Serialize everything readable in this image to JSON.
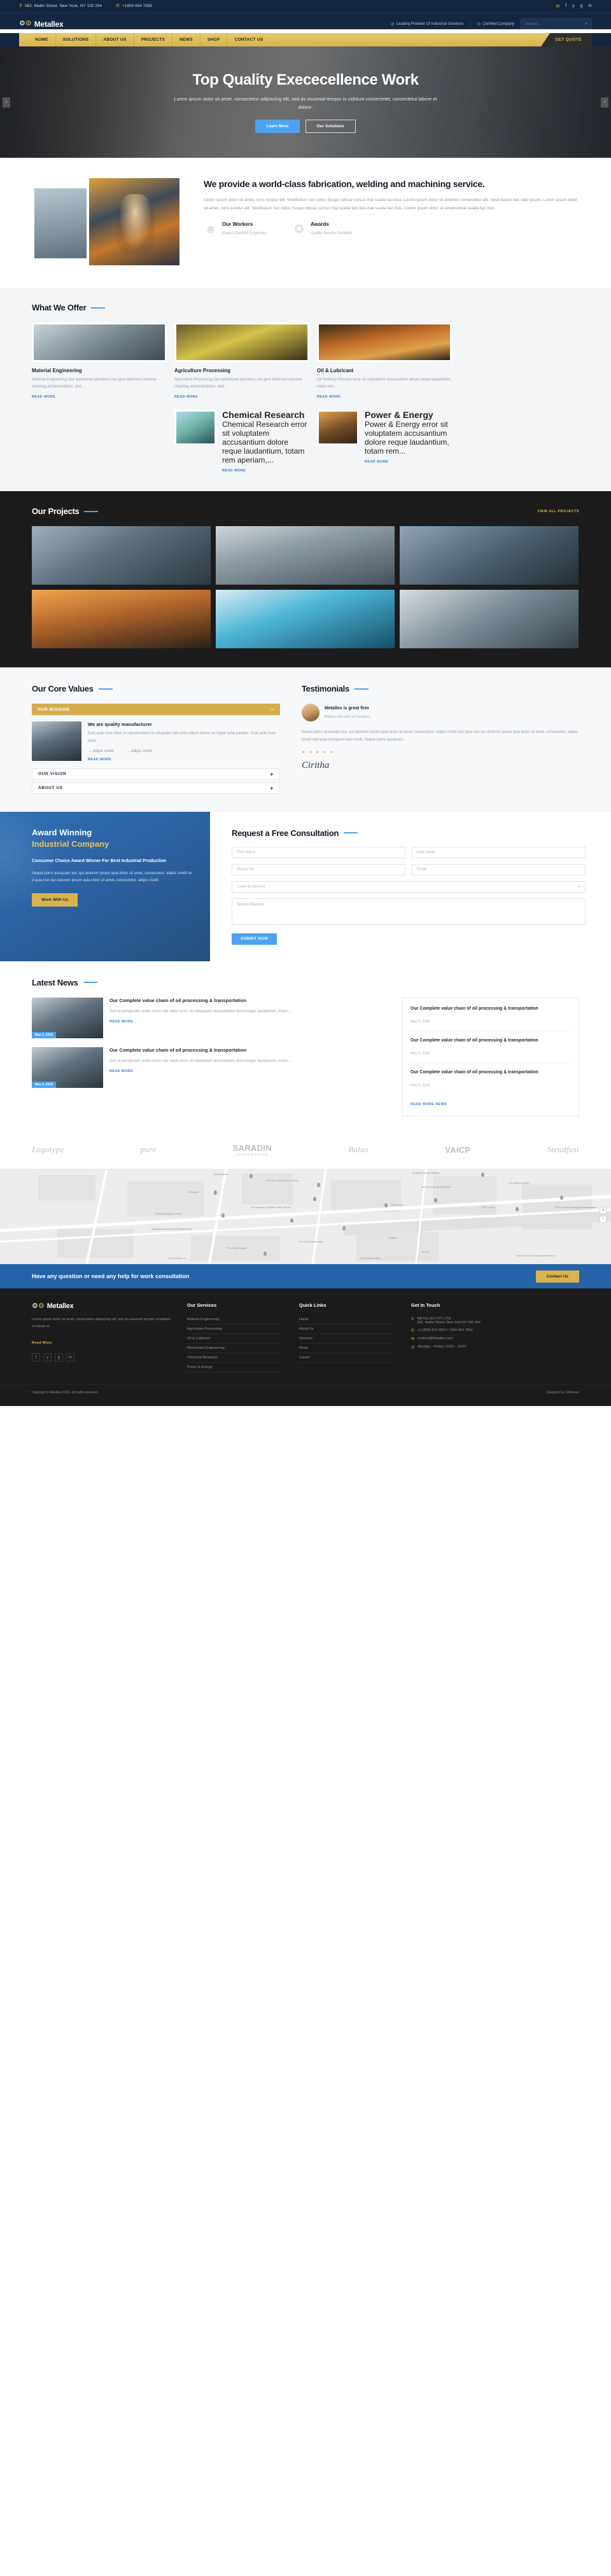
{
  "topbar": {
    "address": "562, Mallin Street, New Youk, NY 100 254",
    "phone": "+1800 654 7895",
    "social": [
      "✉",
      "f",
      "y",
      "g",
      "in"
    ]
  },
  "header": {
    "logo": "Metallex",
    "badges": [
      "Leading Provider Of Industrial Solutions",
      "Certified Company"
    ],
    "search_placeholder": "Search..."
  },
  "nav": {
    "items": [
      "HOME",
      "SOLUTIONS",
      "ABOUT US",
      "PROJECTS",
      "NEWS",
      "SHOP",
      "CONTACT US"
    ],
    "quote_label": "GET QUOTE"
  },
  "hero": {
    "title": "Top Quality Exececellence Work",
    "subtitle": "Lorem ipsum dolor sit amet, consectetur adipiscing elit, sed do eiusmod tempor in cididunt consectetet, consectetut labore et dolore.",
    "primary_btn": "Learn More",
    "secondary_btn": "Our Solutions"
  },
  "about": {
    "heading": "We provide a world-class fabrication, welding and machining service.",
    "paragraph": "Lorem ipsum dolor sit amet, cons ectetur elit. Vestibulum nec odios Suspe ndisse cursus mal suada faci lisis. Lorem ipsum dolor sit ametion consectetur elit. Vesti bulum nec odio ipsum. Lorem ipsum dolor sit amet, cons ectetur elit. Vestibulum nec odios Suspe ndisse cursus mal suada faci lisis mal suada faci lisis. Lorem ipsum dolor sit ametionmal suada faci lisis.",
    "features": [
      {
        "icon": "worker-icon",
        "title": "Our Workers",
        "subtitle": "Expert Certified Engineers"
      },
      {
        "icon": "award-icon",
        "title": "Awards",
        "subtitle": "Quality Service Certified"
      }
    ]
  },
  "offer": {
    "title": "What We Offer",
    "read_more": "READ MORE",
    "cards": [
      {
        "title": "Material Engineering",
        "text": "Material Engineering Our authorized plumbers can give deterrent channel cleaning administrations, and..."
      },
      {
        "title": "Agriculture Processing",
        "text": "Agriculture Processing Our authorized plumbers can give deterrent channel cleaning administrations, and..."
      },
      {
        "title": "Oil & Lubricant",
        "text": "Oil Refinery Process error sit voluptatem accusantium dolore reque laudantium, totam rem..."
      },
      {
        "title": "Chemical Research",
        "text": "Chemical Research error sit voluptatem accusantium dolore reque laudantium, totam rem aperiam,..."
      },
      {
        "title": "Power & Energy",
        "text": "Power & Energy error sit voluptatem accusantium dolore reque laudantium, totam rem..."
      }
    ]
  },
  "projects": {
    "title": "Our Projects",
    "view_all": "VIEW ALL PROJECTS"
  },
  "core": {
    "title": "Our Core Values",
    "accordion": [
      {
        "label": "OUR MISSION",
        "sign": "−",
        "open": true
      },
      {
        "label": "OUR VISION",
        "sign": "+",
        "open": false
      },
      {
        "label": "ABOUT US",
        "sign": "+",
        "open": false
      }
    ],
    "panel": {
      "heading": "We are quality manufacturer",
      "text": "Duis aute irure dolor in reprehenderit in voluptate velit esse cillum dolore eu fugiat nulla pariatur. Duis aute irure dolor",
      "links": [
        "Adipis civelit",
        "Adipis civelit"
      ],
      "read_more": "READ MORE"
    }
  },
  "testimonials": {
    "title": "Testimonials",
    "name": "Metallex is great firm",
    "role": "Motivio simi aDG & Founders",
    "text": "Neque porro quisquam est, qui dolorem ipsum quia dolor sit amet, consectetur, adipis civelit sed quia non qui dolorem ipsum quia dolor sit amet, consectetur, adipis civelit sed quia numquam eius modi. Neque porro quisquam.",
    "stars": "★ ★ ★ ★ ★",
    "signature": "Ciritha"
  },
  "award": {
    "title_line1": "Award Winning",
    "title_line2": "Industrial Company",
    "subtitle": "Consumer Choice Award Winner For Best Industrial Production",
    "text": "Neque porro quisquam est, qui dolorem ipsum quia dolor sit amet, consectetur, adipis civelit se d quia non qui dolorem ipsum quia dolor sit amet, consectetur, adipis civelit",
    "button": "Work With Us"
  },
  "consult": {
    "title": "Request a Free Consultation",
    "first_name": "First Name",
    "last_name": "Last Name",
    "phone": "Phone No.",
    "email": "Email",
    "select": "I want to discuss",
    "message": "Special Request",
    "submit": "SUBMIT NOW"
  },
  "news": {
    "title": "Latest News",
    "read_more": "READ MORE",
    "read_more_news": "READ MORE NEWS",
    "items": [
      {
        "badge": "May 3, 2018",
        "title": "Our Complete value chain of oil processing & transportation",
        "text": "Sed ut perspiciatis unde omnis iste natus error sit voluptatem accusantium doloremque laudantium, totam..."
      },
      {
        "badge": "May 3, 2018",
        "title": "Our Complete value chain of oil processing & transportation",
        "text": "Sed ut perspiciatis unde omnis iste natus error sit voluptatem accusantium doloremque laudantium, totam..."
      }
    ],
    "recent": [
      {
        "title": "Our Complete value chain of oil processing & transportation",
        "date": "May 3, 2018"
      },
      {
        "title": "Our Complete value chain of oil processing & transportation",
        "date": "May 3, 2018"
      },
      {
        "title": "Our Complete value chain of oil processing & transportation",
        "date": "May 3, 2018"
      }
    ]
  },
  "brands": [
    {
      "name": "Logotype",
      "sub": ""
    },
    {
      "name": "pure",
      "sub": ""
    },
    {
      "name": "SARADIN",
      "sub": "CORPORATION"
    },
    {
      "name": "Balax",
      "sub": ""
    },
    {
      "name": "VAICP",
      "sub": ""
    },
    {
      "name": "Steadfast",
      "sub": ""
    }
  ],
  "map": {
    "zoom_in": "+",
    "zoom_out": "−",
    "labels": [
      "Debenhams",
      "An Post, General Post Office",
      "Penneys",
      "The Academy, Middle Abbey Street",
      "Jervis Shopping Centre",
      "Национальный музей лепреконов",
      "O'Connell Monument",
      "The Grand Social",
      "Busáras Central Station",
      "James Connolly Memorial",
      "IFSC House",
      "EPIC Музей ирландской эмиграции",
      "ELY BAR & GRILL",
      "Аббі-театр",
      "Лиффи",
      "Tara St",
      "The National Wax",
      "Irish Seaman's National Memorial",
      "The Morrison, a"
    ]
  },
  "cta": {
    "text": "Have any question or need any help for work consultation",
    "button": "Contact Us"
  },
  "footer": {
    "logo": "Metallex",
    "about": "Lorem ipsum dolor sit amet, consectetur adipiscing elit, sed do eiusmod tempor incididunt ut labore et.",
    "read_more": "Read More",
    "social": [
      "f",
      "y",
      "g",
      "in"
    ],
    "columns": [
      {
        "title": "Our Services",
        "items": [
          "Material Engineering",
          "Agriculture Processing",
          "Oil & Lubricant",
          "Mechanical Engineering",
          "Chemical Research",
          "Power & Energy"
        ]
      },
      {
        "title": "Quick Links",
        "items": [
          "Home",
          "About Us",
          "Services",
          "News",
          "Career"
        ]
      }
    ],
    "contact_title": "Get In Touch",
    "contact": [
      {
        "icon": "pin-icon",
        "text": "METALLEX PVT. LTD.\n562, Mallin Street, New York NY 100 254"
      },
      {
        "icon": "phone-icon",
        "text": "+1 (800) 624 8924 / 1254 854 7854"
      },
      {
        "icon": "mail-icon",
        "text": "contact@Metallex.com"
      },
      {
        "icon": "clock-icon",
        "text": "Monday – Friday / 9:00 – 19:00"
      }
    ],
    "copyright": "Copyright © Metallex 2018 - All rights reserved.",
    "designed": "Designed by: Uithemes"
  }
}
